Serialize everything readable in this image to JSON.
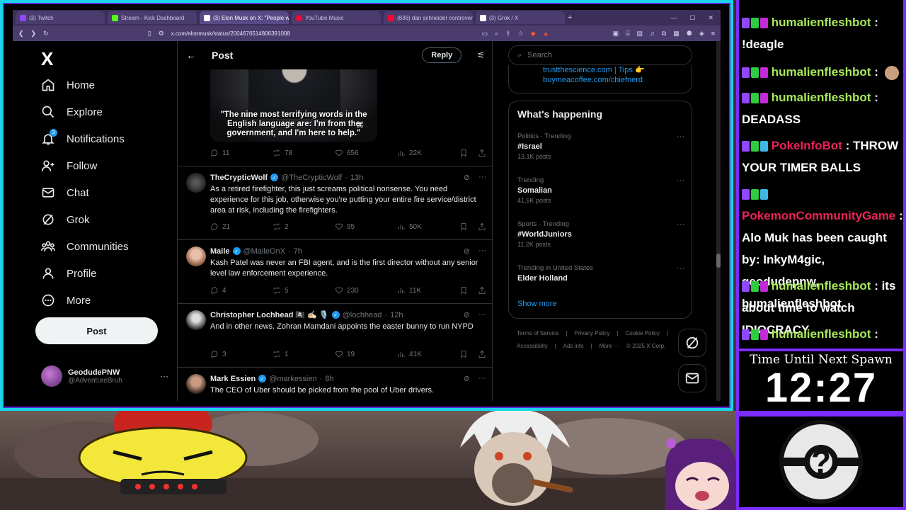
{
  "browser": {
    "tabs": [
      {
        "title": "(3) Twitch",
        "color": "#9146ff"
      },
      {
        "title": "Stream - Kick Dashboard",
        "color": "#53fc18"
      },
      {
        "title": "(3) Elon Musk on X: \"People will",
        "color": "#ffffff"
      },
      {
        "title": "YouTube Music",
        "color": "#ff0033"
      },
      {
        "title": "(836) dan schneider controversy - Yo",
        "color": "#ff0033"
      },
      {
        "title": "(3) Grok / X",
        "color": "#ffffff"
      }
    ],
    "url": "x.com/elonmusk/status/2004676514806391008"
  },
  "nav": {
    "logo": "X",
    "items": [
      {
        "label": "Home",
        "icon": "home-icon"
      },
      {
        "label": "Explore",
        "icon": "search-icon"
      },
      {
        "label": "Notifications",
        "icon": "bell-icon"
      },
      {
        "label": "Follow",
        "icon": "follow-icon"
      },
      {
        "label": "Chat",
        "icon": "mail-icon"
      },
      {
        "label": "Grok",
        "icon": "grok-icon"
      },
      {
        "label": "Communities",
        "icon": "communities-icon"
      },
      {
        "label": "Profile",
        "icon": "profile-icon"
      },
      {
        "label": "More",
        "icon": "more-icon"
      }
    ],
    "notif_badge": "3",
    "post_label": "Post",
    "account": {
      "name": "GeodudePNW",
      "handle": "@AdventureBruh"
    }
  },
  "center": {
    "title": "Post",
    "reply_label": "Reply",
    "meme_caption": "\"The nine most terrifying words in the English language are: I'm from the government, and I'm here to help.\"",
    "main_stats": {
      "replies": "11",
      "reposts": "78",
      "likes": "656",
      "views": "22K"
    },
    "replies": [
      {
        "name": "TheCrypticWolf",
        "handle": "@TheCrypticWolf",
        "time": "13h",
        "text": "As a retired firefighter, this just screams political nonsense. You need experience for this job, otherwise you're putting your entire fire service/district area at risk, including the firefighters.",
        "stats": {
          "replies": "21",
          "reposts": "2",
          "likes": "95",
          "views": "50K"
        }
      },
      {
        "name": "Maile",
        "handle": "@MaileOnX",
        "time": "7h",
        "text": "Kash Patel was never an FBI agent, and is the first director without any senior level law enforcement experience.",
        "stats": {
          "replies": "4",
          "reposts": "5",
          "likes": "230",
          "views": "11K"
        }
      },
      {
        "name": "Christopher Lochhead 🏴‍☠️ ✍🏻 🎙️",
        "handle": "@lochhead",
        "time": "12h",
        "text": "And in other news. Zohran Mamdani appoints the easter bunny to run NYPD",
        "stats": {
          "replies": "3",
          "reposts": "1",
          "likes": "19",
          "views": "41K"
        }
      },
      {
        "name": "Mark Essien",
        "handle": "@markessien",
        "time": "8h",
        "text": "The CEO of Uber should be picked from the pool of Uber drivers.",
        "stats": {
          "replies": "",
          "reposts": "",
          "likes": "",
          "views": ""
        }
      }
    ]
  },
  "right": {
    "search_placeholder": "Search",
    "links": [
      "trustthescience.com | Tips 👉",
      "buymeacoffee.com/chiefnerd"
    ],
    "trends_title": "What's happening",
    "trends": [
      {
        "meta": "Politics · Trending",
        "name": "#Israel",
        "count": "13.1K posts"
      },
      {
        "meta": "Trending",
        "name": "Somalian",
        "count": "41.6K posts"
      },
      {
        "meta": "Sports · Trending",
        "name": "#WorldJuniors",
        "count": "11.2K posts"
      },
      {
        "meta": "Trending in United States",
        "name": "Elder Holland",
        "count": ""
      }
    ],
    "show_more": "Show more",
    "footer": [
      "Terms of Service",
      "|",
      "Privacy Policy",
      "|",
      "Cookie Policy",
      "|",
      "Accessibility",
      "|",
      "Ads info",
      "|",
      "More ···",
      "© 2025 X Corp."
    ]
  },
  "chat": {
    "lines": [
      {
        "user": "humalienfleshbot",
        "msg": "!deagle",
        "red": false
      },
      {
        "user": "humalienfleshbot",
        "msg": "",
        "red": false
      },
      {
        "user": "humalienfleshbot",
        "msg": "DEADASS",
        "red": false
      },
      {
        "user": "PokeInfoBot",
        "msg": "THROW YOUR TIMER BALLS",
        "red": true
      },
      {
        "user": "PokemonCommunityGame",
        "msg": "Alo Muk has been caught by: InkyM4gic, geodudepnw, humalienfleshbot",
        "red": true
      },
      {
        "user": "humalienfleshbot",
        "msg": "its about time to watch IDIOCRACY",
        "red": false
      },
      {
        "user": "humalienfleshbot",
        "msg": "",
        "red": false
      }
    ]
  },
  "overlay": {
    "timer_label": "Time Until Next Spawn",
    "timer_value": "12:27"
  }
}
